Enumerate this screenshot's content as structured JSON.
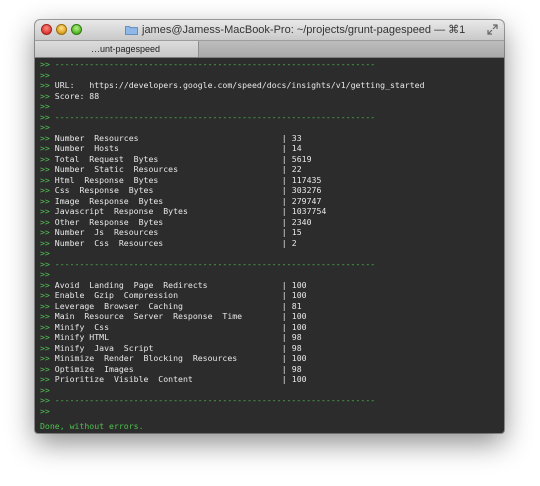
{
  "window": {
    "title": "james@Jamess-MacBook-Pro: ~/projects/grunt-pagespeed — ⌘1",
    "tab_label": "…unt-pagespeed"
  },
  "terminal": {
    "prompt": ">>",
    "separator": "-----------------------------------------------------------------",
    "url_label": "URL:",
    "url_value": "https://developers.google.com/speed/docs/insights/v1/getting_started",
    "score_text": "Score: 88",
    "pipe": "|",
    "resources": [
      {
        "label": "Number  Resources",
        "value": "33"
      },
      {
        "label": "Number  Hosts",
        "value": "14"
      },
      {
        "label": "Total  Request  Bytes",
        "value": "5619"
      },
      {
        "label": "Number  Static  Resources",
        "value": "22"
      },
      {
        "label": "Html  Response  Bytes",
        "value": "117435"
      },
      {
        "label": "Css  Response  Bytes",
        "value": "303276"
      },
      {
        "label": "Image  Response  Bytes",
        "value": "279747"
      },
      {
        "label": "Javascript  Response  Bytes",
        "value": "1037754"
      },
      {
        "label": "Other  Response  Bytes",
        "value": "2340"
      },
      {
        "label": "Number  Js  Resources",
        "value": "15"
      },
      {
        "label": "Number  Css  Resources",
        "value": "2"
      }
    ],
    "rules": [
      {
        "label": "Avoid  Landing  Page  Redirects",
        "value": "100"
      },
      {
        "label": "Enable  Gzip  Compression",
        "value": "100"
      },
      {
        "label": "Leverage  Browser  Caching",
        "value": "81"
      },
      {
        "label": "Main  Resource  Server  Response  Time",
        "value": "100"
      },
      {
        "label": "Minify  Css",
        "value": "100"
      },
      {
        "label": "Minify HTML",
        "value": "98"
      },
      {
        "label": "Minify  Java  Script",
        "value": "98"
      },
      {
        "label": "Minimize  Render  Blocking  Resources",
        "value": "100"
      },
      {
        "label": "Optimize  Images",
        "value": "98"
      },
      {
        "label": "Prioritize  Visible  Content",
        "value": "100"
      }
    ],
    "done_text": "Done, without errors."
  }
}
